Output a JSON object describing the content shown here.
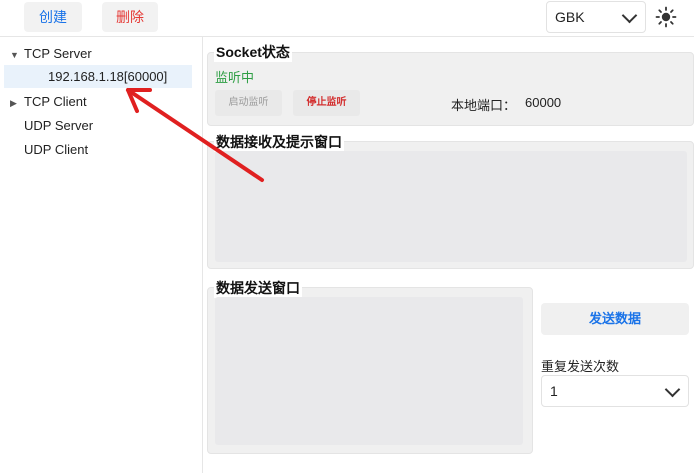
{
  "toolbar": {
    "create_label": "创建",
    "delete_label": "删除",
    "encoding_value": "GBK",
    "theme_icon": "sun-icon",
    "colors": {
      "create": "#1a73e8",
      "delete": "#e53935"
    }
  },
  "tree": {
    "tcp_server": "TCP Server",
    "tcp_server_child": "192.168.1.18[60000]",
    "tcp_client": "TCP Client",
    "udp_server": "UDP Server",
    "udp_client": "UDP Client"
  },
  "socket": {
    "title": "Socket状态",
    "status": "监听中",
    "status_color": "#2e9e44",
    "start_label": "启动监听",
    "stop_label": "停止监听",
    "local_port_label": "本地端口：",
    "local_port_value": "60000"
  },
  "receive": {
    "title": "数据接收及提示窗口",
    "content": ""
  },
  "send": {
    "title": "数据发送窗口",
    "content": "",
    "send_button": "发送数据",
    "repeat_label": "重复发送次数",
    "repeat_value": "1"
  }
}
